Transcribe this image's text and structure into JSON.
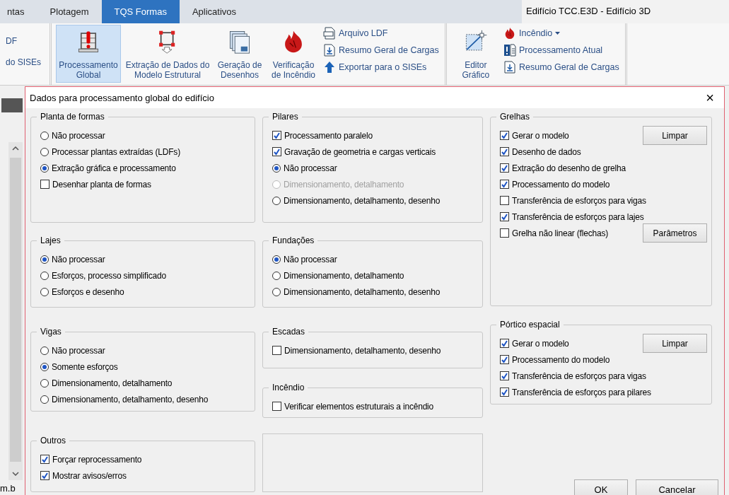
{
  "ribbon": {
    "tabs": [
      {
        "label": "ntas",
        "selected": false
      },
      {
        "label": "Plotagem",
        "selected": false
      },
      {
        "label": "TQS Formas",
        "selected": true
      },
      {
        "label": "Aplicativos",
        "selected": false
      }
    ],
    "title": "Edifício TCC.E3D - Edifício 3D",
    "left_items": [
      "DF",
      "do SISEs"
    ],
    "large_buttons": [
      {
        "label": "Processamento Global",
        "selected": true
      },
      {
        "label": "Extração de Dados do Modelo Estrutural",
        "selected": false
      },
      {
        "label": "Geração de Desenhos",
        "selected": false
      },
      {
        "label": "Verificação de Incêndio",
        "selected": false
      }
    ],
    "small_buttons": [
      {
        "label": "Arquivo LDF"
      },
      {
        "label": "Resumo Geral de Cargas"
      },
      {
        "label": "Exportar para o SISEs"
      }
    ],
    "editor": {
      "label": "Editor Gráfico"
    },
    "small_buttons_2": [
      {
        "label": "Incêndio",
        "dropdown": true
      },
      {
        "label": "Processamento Atual"
      },
      {
        "label": "Resumo Geral de Cargas"
      }
    ]
  },
  "background": {
    "status_text": "m.b"
  },
  "dialog": {
    "title": "Dados para processamento global do edifício",
    "close": "×",
    "columns": [
      [
        {
          "title": "Planta de formas",
          "items": [
            {
              "kind": "radio",
              "label": "Não processar",
              "selected": false
            },
            {
              "kind": "radio",
              "label": "Processar plantas extraídas (LDFs)",
              "selected": false
            },
            {
              "kind": "radio",
              "label": "Extração gráfica e processamento",
              "selected": true
            },
            {
              "kind": "checkbox",
              "label": "Desenhar planta de formas",
              "checked": false
            }
          ]
        },
        {
          "title": "Lajes",
          "items": [
            {
              "kind": "radio",
              "label": "Não processar",
              "selected": true
            },
            {
              "kind": "radio",
              "label": "Esforços, processo simplificado",
              "selected": false
            },
            {
              "kind": "radio",
              "label": "Esforços e desenho",
              "selected": false
            }
          ]
        },
        {
          "title": "Vigas",
          "items": [
            {
              "kind": "radio",
              "label": "Não processar",
              "selected": false
            },
            {
              "kind": "radio",
              "label": "Somente esforços",
              "selected": true
            },
            {
              "kind": "radio",
              "label": "Dimensionamento, detalhamento",
              "selected": false
            },
            {
              "kind": "radio",
              "label": "Dimensionamento, detalhamento, desenho",
              "selected": false
            }
          ]
        },
        {
          "title": "Outros",
          "items": [
            {
              "kind": "checkbox",
              "label": "Forçar reprocessamento",
              "checked": true
            },
            {
              "kind": "checkbox",
              "label": "Mostrar avisos/erros",
              "checked": true
            }
          ]
        }
      ],
      [
        {
          "title": "Pilares",
          "items": [
            {
              "kind": "checkbox",
              "label": "Processamento paralelo",
              "checked": true
            },
            {
              "kind": "checkbox",
              "label": "Gravação de geometria e cargas verticais",
              "checked": true
            },
            {
              "kind": "radio",
              "label": "Não processar",
              "selected": true,
              "disabled": false
            },
            {
              "kind": "radio",
              "label": "Dimensionamento, detalhamento",
              "selected": false,
              "disabled": true
            },
            {
              "kind": "radio",
              "label": "Dimensionamento, detalhamento, desenho",
              "selected": false,
              "disabled": false
            }
          ]
        },
        {
          "title": "Fundações",
          "items": [
            {
              "kind": "radio",
              "label": "Não processar",
              "selected": true
            },
            {
              "kind": "radio",
              "label": "Dimensionamento, detalhamento",
              "selected": false
            },
            {
              "kind": "radio",
              "label": "Dimensionamento, detalhamento, desenho",
              "selected": false
            }
          ]
        },
        {
          "title": "Escadas",
          "items": [
            {
              "kind": "checkbox",
              "label": "Dimensionamento, detalhamento, desenho",
              "checked": false
            }
          ]
        },
        {
          "title": "Incêndio",
          "items": [
            {
              "kind": "checkbox",
              "label": "Verificar elementos estruturais a incêndio",
              "checked": false
            }
          ]
        }
      ],
      [
        {
          "title": "Grelhas",
          "items": [
            {
              "kind": "checkbox",
              "label": "Gerar o modelo",
              "checked": true,
              "button": "Limpar"
            },
            {
              "kind": "checkbox",
              "label": "Desenho de dados",
              "checked": true
            },
            {
              "kind": "checkbox",
              "label": "Extração do desenho de grelha",
              "checked": true
            },
            {
              "kind": "checkbox",
              "label": "Processamento do modelo",
              "checked": true
            },
            {
              "kind": "checkbox",
              "label": "Transferência de esforços para vigas",
              "checked": false
            },
            {
              "kind": "checkbox",
              "label": "Transferência de esforços para lajes",
              "checked": true
            },
            {
              "kind": "checkbox",
              "label": "Grelha não linear (flechas)",
              "checked": false,
              "button": "Parâmetros"
            }
          ]
        },
        {
          "title": "Pórtico espacial",
          "items": [
            {
              "kind": "checkbox",
              "label": "Gerar o modelo",
              "checked": true,
              "button": "Limpar"
            },
            {
              "kind": "checkbox",
              "label": "Processamento do modelo",
              "checked": true
            },
            {
              "kind": "checkbox",
              "label": "Transferência de esforços para vigas",
              "checked": true
            },
            {
              "kind": "checkbox",
              "label": "Transferência de esforços para pilares",
              "checked": true
            }
          ]
        }
      ]
    ],
    "buttons": [
      "OK",
      "Cancelar"
    ]
  }
}
